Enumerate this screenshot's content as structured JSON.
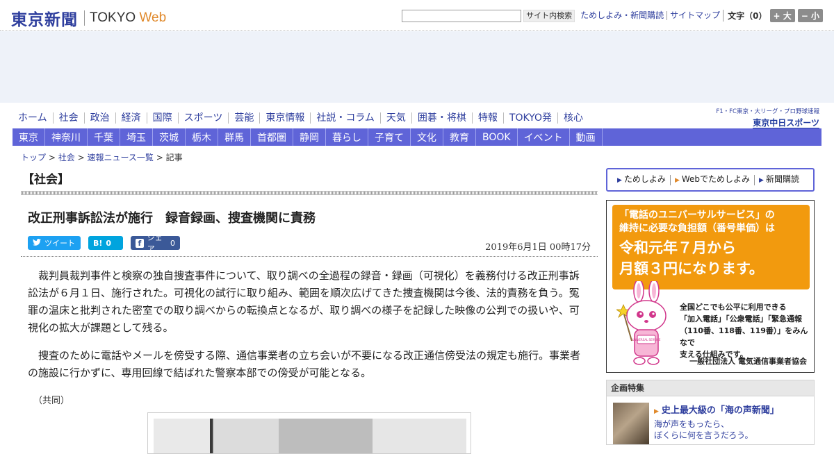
{
  "header": {
    "logo_jp": "東京新聞",
    "logo_en_prefix": "TOKYO",
    "logo_en_suffix": "Web",
    "search_placeholder": "",
    "search_button": "サイト内検索",
    "links": [
      "ためしよみ・新聞購読",
      "サイトマップ"
    ],
    "font_size_label": "文字（0）",
    "font_larger": "+ 大",
    "font_smaller": "− 小"
  },
  "nav_primary": [
    "ホーム",
    "社会",
    "政治",
    "経済",
    "国際",
    "スポーツ",
    "芸能",
    "東京情報",
    "社説・コラム",
    "天気",
    "囲碁・将棋",
    "特報",
    "TOKYO発",
    "核心"
  ],
  "chunichi": {
    "small": "F1・FC東京・大リーグ・プロ野球速報",
    "big": "東京中日スポーツ"
  },
  "nav_secondary": [
    "東京",
    "神奈川",
    "千葉",
    "埼玉",
    "茨城",
    "栃木",
    "群馬",
    "首都圏",
    "静岡",
    "暮らし",
    "子育て",
    "文化",
    "教育",
    "BOOK",
    "イベント",
    "動画"
  ],
  "breadcrumb": {
    "items": [
      "トップ",
      "社会",
      "速報ニュース一覧"
    ],
    "sep": ">",
    "current": "記事"
  },
  "article": {
    "section": "【社会】",
    "headline": "改正刑事訴訟法が施行　録音録画、捜査機関に責務",
    "share": {
      "tweet": "ツイート",
      "hatena_icon": "B!",
      "hatena_count": "0",
      "fb_icon": "f",
      "fb_label": "シェア",
      "fb_count": "0"
    },
    "date": "2019年6月1日 00時17分",
    "paragraphs": [
      "裁判員裁判事件と検察の独自捜査事件について、取り調べの全過程の録音・録画（可視化）を義務付ける改正刑事訴訟法が６月１日、施行された。可視化の試行に取り組み、範囲を順次広げてきた捜査機関は今後、法的責務を負う。冤罪の温床と批判された密室での取り調べからの転換点となるが、取り調べの様子を記録した映像の公判での扱いや、可視化の拡大が課題として残る。",
      "捜査のために電話やメールを傍受する際、通信事業者の立ち会いが不要になる改正通信傍受法の規定も施行。事業者の施設に行かずに、専用回線で結ばれた警察本部での傍受が可能となる。"
    ],
    "credit": "（共同）"
  },
  "sidebar": {
    "promo": [
      "ためしよみ",
      "Webでためしよみ",
      "新聞購読"
    ],
    "ad": {
      "line1a": "「電話のユニバーサルサービス」の",
      "line1b": "維持に必要な負担額（番号単価）は",
      "line2a": "令和元年７月から",
      "line2b": "月額３円になります。",
      "lower1": "全国どこでも公平に利用できる",
      "lower2": "「加入電話」「公衆電話」「緊急通報",
      "lower3": "（110番、118番、119番）」をみんなで",
      "lower4": "支える仕組みです。",
      "org": "一般社団法人 電気通信事業者協会",
      "mascot_badge": "UNIVERSAL SERVICE"
    },
    "kikaku": {
      "header": "企画特集",
      "title": "史上最大級の「海の声新聞」",
      "desc1": "海が声をもったら、",
      "desc2": "ぼくらに何を言うだろう。"
    }
  },
  "colors": {
    "brand_blue": "#2f3f9e",
    "nav_purple": "#5f64d8",
    "accent_orange": "#f29a0e",
    "twitter": "#1da1f2",
    "hatena": "#00a4de",
    "facebook": "#3b5998"
  }
}
